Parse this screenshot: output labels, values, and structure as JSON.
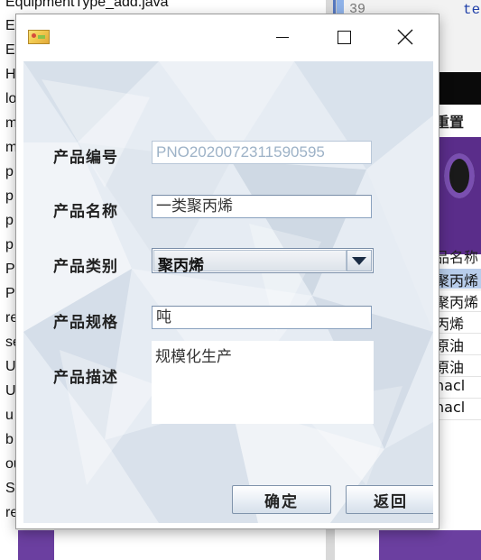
{
  "background": {
    "file_list": [
      "EquipmentType_add.java",
      "E",
      "E",
      "H",
      "lo",
      "m",
      "m",
      "p",
      "p",
      "p",
      "p",
      "P",
      "P",
      "re",
      "se",
      "U",
      "U",
      "u",
      "b",
      "ou",
      "Sys",
      "ren"
    ],
    "editor": {
      "line_number": "39",
      "code_fragment": "te"
    },
    "app": {
      "reset_label": "重置",
      "table_header": "品名称",
      "table_cells": [
        "聚丙烯",
        "聚丙烯",
        "丙烯",
        "原油",
        "原油",
        "nacl",
        "nacl"
      ]
    }
  },
  "dialog": {
    "window_title": "",
    "icons": {
      "app": "java-app-icon",
      "minimize": "minimize-icon",
      "maximize": "maximize-icon",
      "close": "close-icon"
    },
    "fields": {
      "code": {
        "label": "产品编号",
        "value": "PNO2020072311590595"
      },
      "name": {
        "label": "产品名称",
        "value": "一类聚丙烯"
      },
      "category": {
        "label": "产品类别",
        "value": "聚丙烯"
      },
      "spec": {
        "label": "产品规格",
        "value": "吨"
      },
      "desc": {
        "label": "产品描述",
        "value": "规模化生产"
      }
    },
    "buttons": {
      "ok": "确定",
      "back": "返回"
    }
  }
}
